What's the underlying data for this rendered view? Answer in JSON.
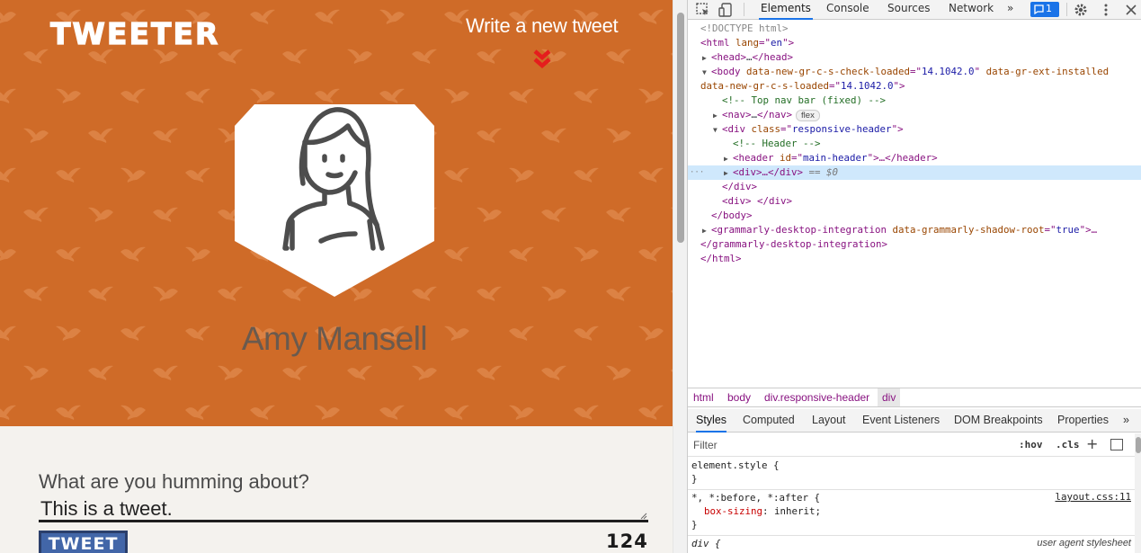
{
  "app": {
    "logo": "TWEETER",
    "write_link": "Write a new tweet",
    "user_name": "Amy Mansell",
    "composer_label": "What are you humming about?",
    "composer_value": "This is a tweet.",
    "tweet_button": "TWEET",
    "char_counter": "124",
    "colors": {
      "header": "#cf6b28",
      "button": "#4266a8",
      "arrow": "#e51d1d"
    },
    "icons": {
      "write": "double-chevron-down-icon",
      "avatar": "person-icon"
    }
  },
  "devtools": {
    "tabs": [
      "Elements",
      "Console",
      "Sources",
      "Network"
    ],
    "active_tab": "Elements",
    "issues_count": "1",
    "more_tabs": "»",
    "dom": {
      "doctype": "<!DOCTYPE html>",
      "html_open": [
        "<html",
        " lang",
        "=\"",
        "en",
        "\">"
      ],
      "head": [
        "<head>",
        "…",
        "</head>"
      ],
      "body_tag": "<body",
      "body_attr1": " data-new-gr-c-s-check-loaded",
      "body_val1": "14.1042.0",
      "body_attr2": " data-gr-ext-installed",
      "body_attr3": "data-new-gr-c-s-loaded",
      "body_val3": "14.1042.0",
      "comment_nav": "<!-- Top nav bar (fixed) -->",
      "nav": [
        "<nav>",
        "…",
        "</nav>"
      ],
      "flex_badge": "flex",
      "div_class_open": "<div",
      "div_class_attr": " class",
      "div_class_val": "responsive-header",
      "comment_header": "<!-- Header -->",
      "header_open": "<header",
      "header_attr": " id",
      "header_val": "main-header",
      "header_rest": ">…</header>",
      "div_selected": "<div>…</div>",
      "eq0": " == $0",
      "div_close": "</div>",
      "div_empty": "<div> </div>",
      "body_close": "</body>",
      "grammarly_open": "<grammarly-desktop-integration",
      "grammarly_attr": " data-grammarly-shadow-root",
      "grammarly_val": "true",
      "grammarly_rest": ">…",
      "grammarly_close": "</grammarly-desktop-integration>",
      "html_close": "</html>"
    },
    "breadcrumbs": [
      "html",
      "body",
      "div.responsive-header",
      "div"
    ],
    "sub_tabs": [
      "Styles",
      "Computed",
      "Layout",
      "Event Listeners",
      "DOM Breakpoints",
      "Properties"
    ],
    "active_sub_tab": "Styles",
    "filter_placeholder": "Filter",
    "hov": ":hov",
    "cls": ".cls",
    "styles": {
      "element_style": "element.style {",
      "close_brace": "}",
      "universal_selector": "*, *:before, *:after {",
      "universal_source": "layout.css:11",
      "box_sizing_prop": "box-sizing",
      "box_sizing_val": "inherit",
      "div_selector": "div {",
      "ua_label": "user agent stylesheet"
    }
  }
}
